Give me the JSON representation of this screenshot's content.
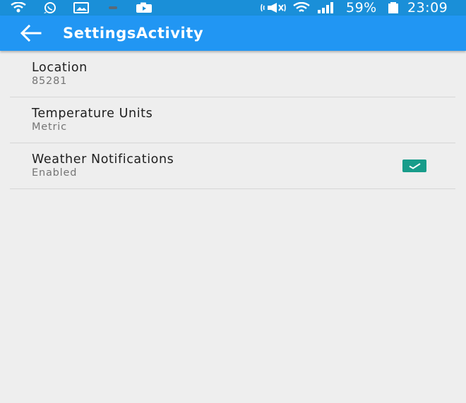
{
  "status_bar": {
    "battery": "59%",
    "time": "23:09",
    "icons": [
      "wifi-call-icon",
      "whatsapp-icon",
      "gallery-icon",
      "minus-icon",
      "camera-icon",
      "mute-icon",
      "wifi-icon",
      "signal-icon",
      "battery-icon"
    ]
  },
  "app_bar": {
    "title": "SettingsActivity",
    "back_icon": "arrow-left-icon"
  },
  "preferences": [
    {
      "title": "Location",
      "summary": "85281"
    },
    {
      "title": "Temperature Units",
      "summary": "Metric"
    },
    {
      "title": "Weather Notifications",
      "summary": "Enabled",
      "checked": true
    }
  ],
  "colors": {
    "status_bar": "#1a8fd8",
    "app_bar": "#2196f3",
    "background": "#eeeeee",
    "checkbox": "#189c8a",
    "title_text": "#202020",
    "summary_text": "#757575"
  }
}
